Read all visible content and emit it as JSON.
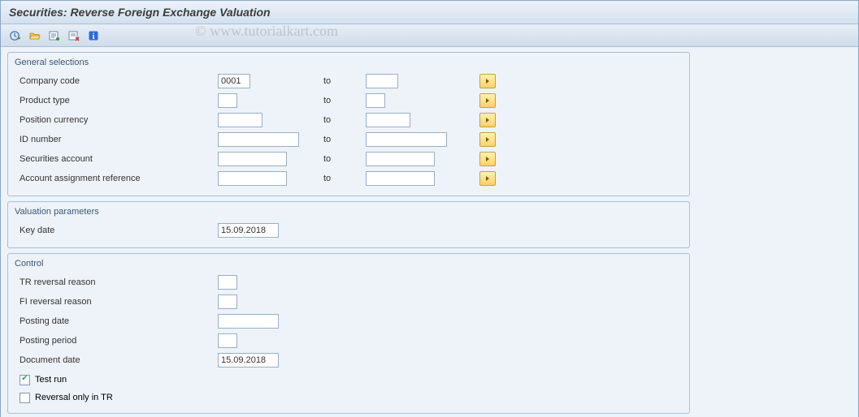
{
  "title": "Securities: Reverse Foreign Exchange Valuation",
  "watermark": "© www.tutorialkart.com",
  "group_general": {
    "title": "General selections",
    "rows": {
      "company_code": {
        "label": "Company code",
        "from": "0001",
        "to_label": "to",
        "to": ""
      },
      "product_type": {
        "label": "Product type",
        "from": "",
        "to_label": "to",
        "to": ""
      },
      "position_currency": {
        "label": "Position currency",
        "from": "",
        "to_label": "to",
        "to": ""
      },
      "id_number": {
        "label": "ID number",
        "from": "",
        "to_label": "to",
        "to": ""
      },
      "securities_account": {
        "label": "Securities account",
        "from": "",
        "to_label": "to",
        "to": ""
      },
      "account_assignment_reference": {
        "label": "Account assignment reference",
        "from": "",
        "to_label": "to",
        "to": ""
      }
    }
  },
  "group_valuation": {
    "title": "Valuation parameters",
    "key_date": {
      "label": "Key date",
      "value": "15.09.2018"
    }
  },
  "group_control": {
    "title": "Control",
    "tr_reversal_reason": {
      "label": "TR reversal reason",
      "value": ""
    },
    "fi_reversal_reason": {
      "label": "FI reversal reason",
      "value": ""
    },
    "posting_date": {
      "label": "Posting date",
      "value": ""
    },
    "posting_period": {
      "label": "Posting period",
      "value": ""
    },
    "document_date": {
      "label": "Document date",
      "value": "15.09.2018"
    },
    "test_run": {
      "label": "Test run",
      "checked": true
    },
    "reversal_only_in_tr": {
      "label": "Reversal only in TR",
      "checked": false
    }
  }
}
